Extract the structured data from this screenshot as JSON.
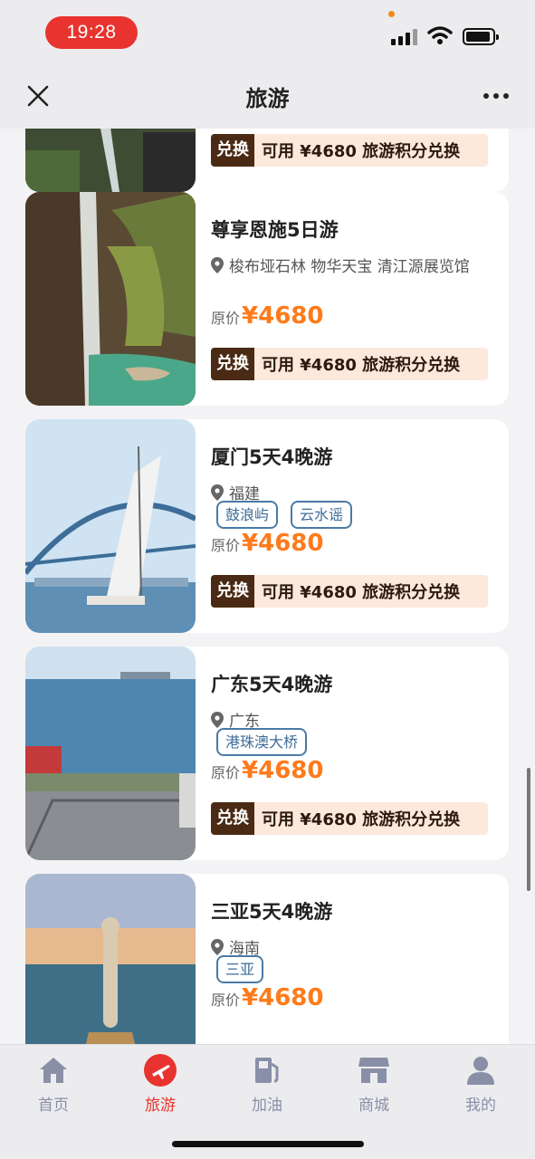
{
  "status_bar": {
    "time": "19:28"
  },
  "nav": {
    "title": "旅游",
    "close_icon": "close-icon",
    "more_icon": "more-icon"
  },
  "cards": [
    {
      "title": "",
      "redeem_button": "兑换",
      "redeem_text": "可用 ¥4680 旅游积分兑换"
    },
    {
      "title": "尊享恩施5日游",
      "location": "梭布垭石林 物华天宝 清江源展览馆",
      "price_label": "原价",
      "price": "¥4680",
      "redeem_button": "兑换",
      "redeem_text": "可用 ¥4680 旅游积分兑换"
    },
    {
      "title": "厦门5天4晚游",
      "location": "福建",
      "tags": [
        "鼓浪屿",
        "云水谣"
      ],
      "price_label": "原价",
      "price": "¥4680",
      "redeem_button": "兑换",
      "redeem_text": "可用 ¥4680 旅游积分兑换"
    },
    {
      "title": "广东5天4晚游",
      "location": "广东",
      "tags": [
        "港珠澳大桥"
      ],
      "price_label": "原价",
      "price": "¥4680",
      "redeem_button": "兑换",
      "redeem_text": "可用 ¥4680 旅游积分兑换"
    },
    {
      "title": "三亚5天4晚游",
      "location": "海南",
      "tags": [
        "三亚"
      ],
      "price_label": "原价",
      "price": "¥4680"
    }
  ],
  "tab_bar": {
    "items": [
      {
        "label": "首页",
        "icon": "home-icon",
        "active": false
      },
      {
        "label": "旅游",
        "icon": "plane-icon",
        "active": true
      },
      {
        "label": "加油",
        "icon": "fuel-icon",
        "active": false
      },
      {
        "label": "商城",
        "icon": "store-icon",
        "active": false
      },
      {
        "label": "我的",
        "icon": "user-icon",
        "active": false
      }
    ]
  },
  "colors": {
    "accent_red": "#e8332e",
    "price_orange": "#ff7a1a",
    "tag_blue": "#4a7aa6",
    "redeem_dark": "#4a2a14",
    "redeem_bg": "#fde8dc"
  }
}
